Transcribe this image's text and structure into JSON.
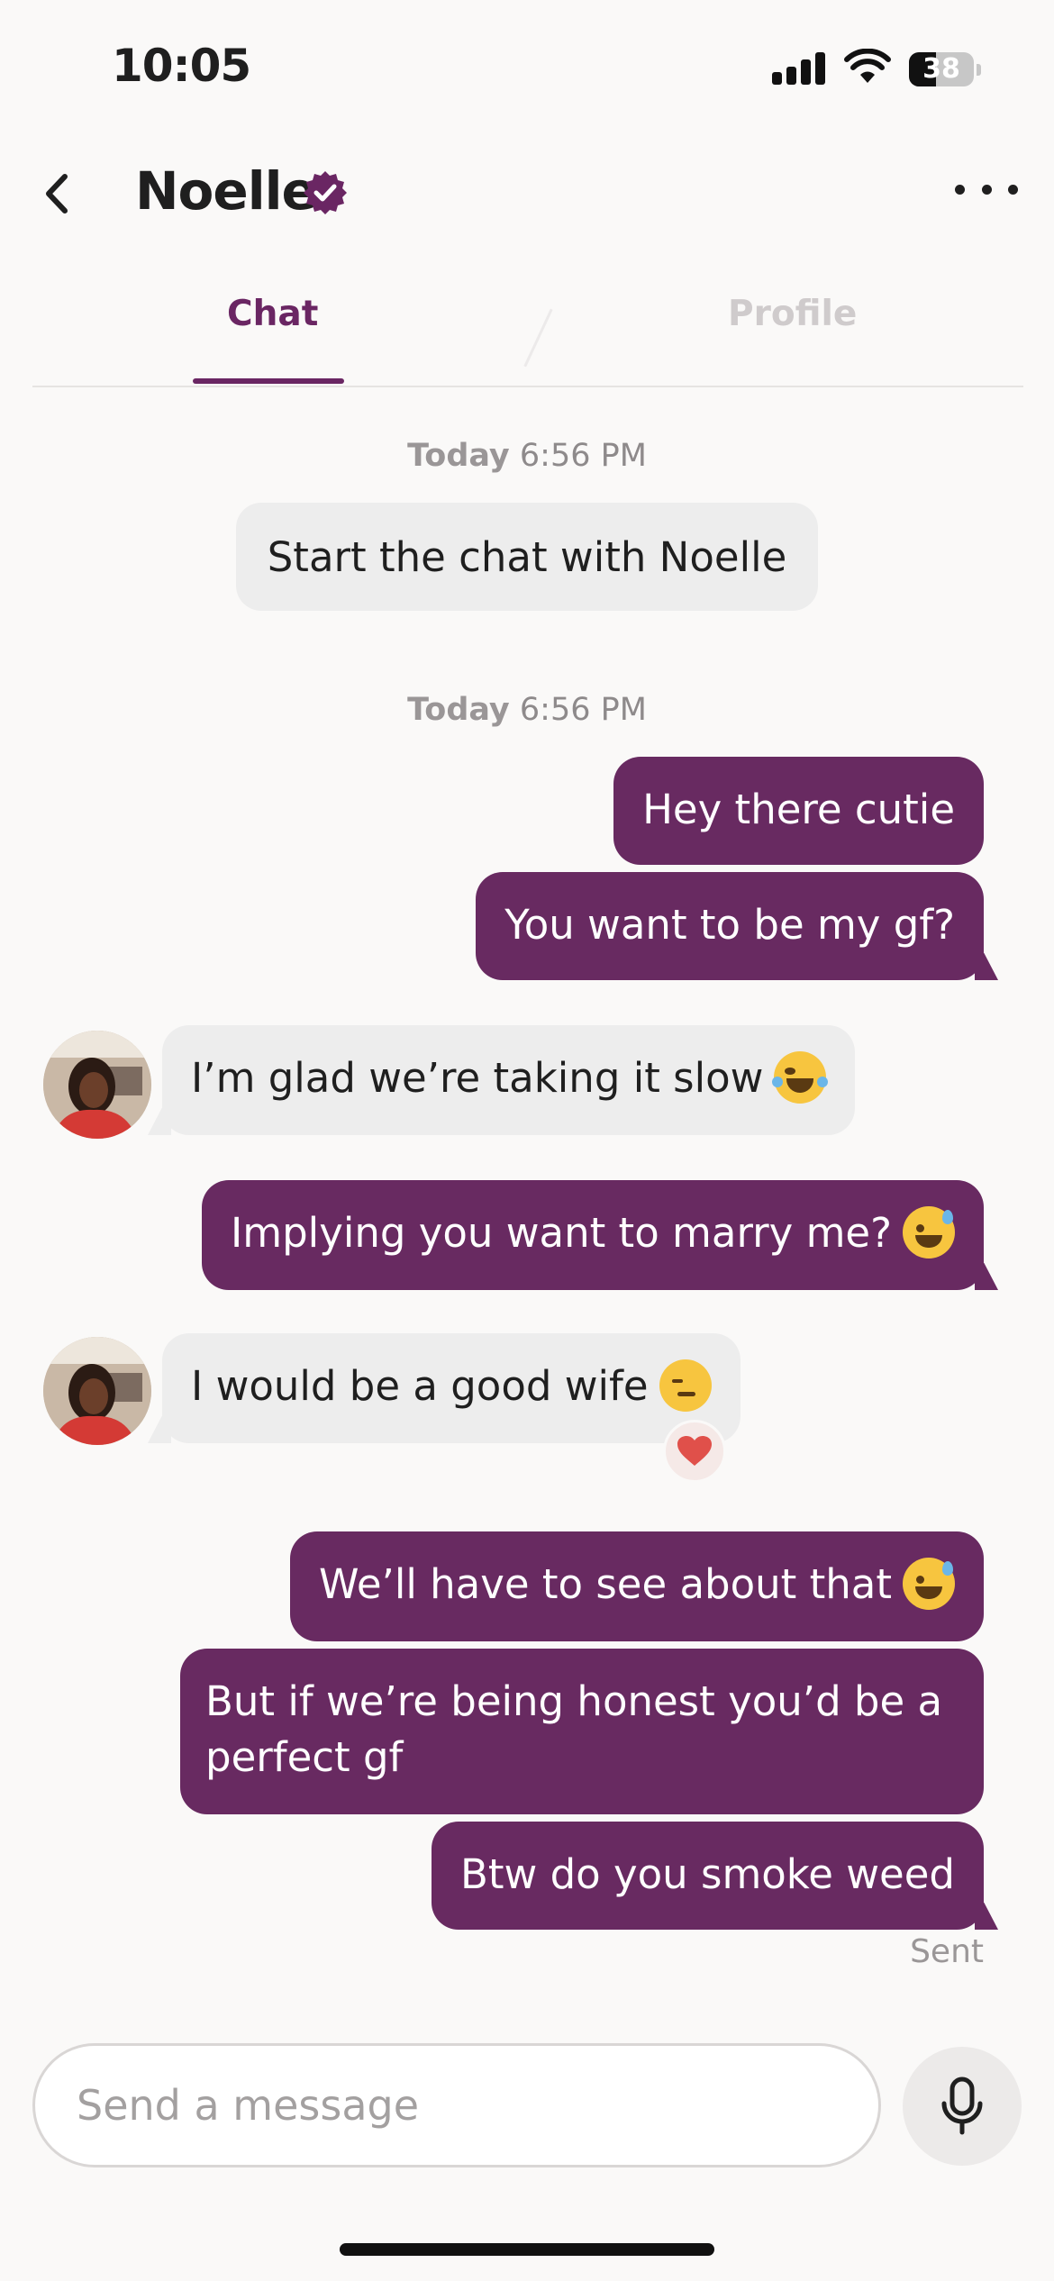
{
  "status_bar": {
    "time": "10:05",
    "battery": "38"
  },
  "header": {
    "name": "Noelle"
  },
  "tabs": [
    {
      "label": "Chat",
      "active": true
    },
    {
      "label": "Profile",
      "active": false
    }
  ],
  "conversation": {
    "timestamps": [
      {
        "day": "Today",
        "time": "6:56 PM"
      },
      {
        "day": "Today",
        "time": "6:56 PM"
      }
    ],
    "system_prompt": "Start the chat with Noelle",
    "messages": [
      {
        "from": "me",
        "text": "Hey there cutie"
      },
      {
        "from": "me",
        "text": "You want to be my gf?"
      },
      {
        "from": "them",
        "text": "I’m glad we’re taking it slow",
        "emoji": "tears-of-joy"
      },
      {
        "from": "me",
        "text": "Implying you want to marry me?",
        "emoji": "grinning-sweat"
      },
      {
        "from": "them",
        "text": "I would be a good wife",
        "emoji": "wink",
        "reaction": "heart"
      },
      {
        "from": "me",
        "text": "We’ll have to see about that",
        "emoji": "grinning-sweat"
      },
      {
        "from": "me",
        "text": "But if we’re being honest you’d be a perfect gf"
      },
      {
        "from": "me",
        "text": "Btw do you smoke weed"
      }
    ],
    "delivery_status": "Sent"
  },
  "composer": {
    "placeholder": "Send a message"
  },
  "colors": {
    "accent": "#6A2663",
    "outgoing_bubble": "#682A61",
    "incoming_bubble": "#EDEDED",
    "background": "#FAF9F8",
    "reaction_heart": "#E0504A"
  },
  "icons": [
    "back-chevron-icon",
    "verified-badge-icon",
    "more-options-icon",
    "heart-reaction-icon",
    "microphone-icon"
  ]
}
